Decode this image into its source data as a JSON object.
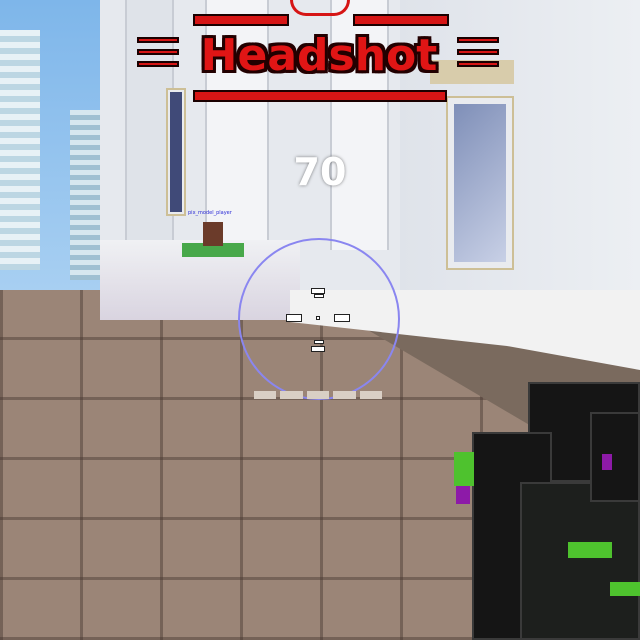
{
  "hud": {
    "kill_banner": "Headshot",
    "score_popup": "70",
    "enemy_nameplate": "pix_model_player",
    "reload_segments": 5,
    "reload_fill": 1.0
  },
  "colors": {
    "banner_red": "#d61515",
    "banner_outline": "#220000",
    "crosshair_ring": "#8a86f0",
    "weapon_glow": "#4ec22e",
    "weapon_accent": "#8d1aa8"
  },
  "icons": {
    "crosshair": "crosshair-icon",
    "weapon": "voxel-rifle-icon"
  }
}
